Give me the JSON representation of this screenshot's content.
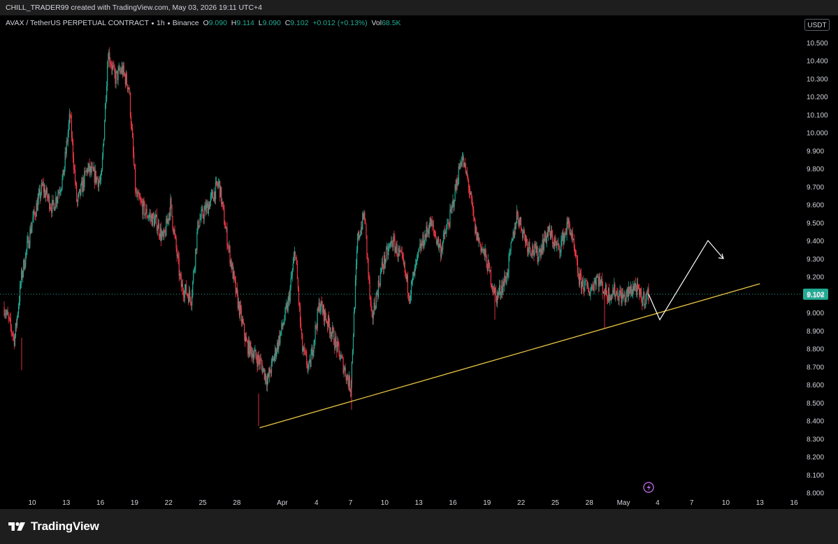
{
  "attribution": "CHILL_TRADER99 created with TradingView.com, May 03, 2026 19:11 UTC+4",
  "header": {
    "symbol": "AVAX / TetherUS PERPETUAL CONTRACT",
    "interval": "1h",
    "exchange": "Binance",
    "open_label": "O",
    "open": "9.090",
    "high_label": "H",
    "high": "9.114",
    "low_label": "L",
    "low": "9.090",
    "close_label": "C",
    "close": "9.102",
    "change": "+0.012 (+0.13%)",
    "vol_label": "Vol",
    "vol": "68.5K"
  },
  "currency_button": "USDT",
  "brand": "TradingView",
  "colors": {
    "up": "#22ab94",
    "down": "#f23645",
    "trendline": "#e8c547",
    "projection": "#ffffff",
    "price_badge": "#22ab94"
  },
  "chart_data": {
    "type": "candlestick",
    "symbol": "AVAX / TetherUS PERPETUAL CONTRACT",
    "timeframe": "1h",
    "y_axis": {
      "range": [
        8.0,
        10.55
      ],
      "ticks": [
        "10.500",
        "10.400",
        "10.300",
        "10.200",
        "10.100",
        "10.000",
        "9.900",
        "9.800",
        "9.700",
        "9.600",
        "9.500",
        "9.400",
        "9.300",
        "9.200",
        "9.100",
        "9.000",
        "8.900",
        "8.800",
        "8.700",
        "8.600",
        "8.500",
        "8.400",
        "8.300",
        "8.200",
        "8.100",
        "8.000"
      ]
    },
    "x_axis": {
      "ticks": [
        "10",
        "13",
        "16",
        "19",
        "22",
        "25",
        "28",
        "Apr",
        "4",
        "7",
        "10",
        "13",
        "16",
        "19",
        "22",
        "25",
        "28",
        "May",
        "4",
        "7",
        "10",
        "13",
        "16"
      ]
    },
    "current_price": {
      "value": 9.102,
      "label": "9.102"
    },
    "price_path": [
      [
        0,
        9.03
      ],
      [
        1.5,
        8.85
      ],
      [
        2.5,
        9.2
      ],
      [
        4,
        9.5
      ],
      [
        5.5,
        9.7
      ],
      [
        7,
        9.58
      ],
      [
        8.5,
        9.75
      ],
      [
        9.5,
        10.1
      ],
      [
        10.5,
        9.6
      ],
      [
        12,
        9.8
      ],
      [
        14,
        9.72
      ],
      [
        15,
        10.45
      ],
      [
        16,
        10.3
      ],
      [
        17,
        10.35
      ],
      [
        18,
        10.25
      ],
      [
        19,
        9.65
      ],
      [
        20.5,
        9.55
      ],
      [
        22,
        9.5
      ],
      [
        23,
        9.4
      ],
      [
        24,
        9.6
      ],
      [
        25.5,
        9.15
      ],
      [
        27,
        9.08
      ],
      [
        28,
        9.5
      ],
      [
        29.5,
        9.6
      ],
      [
        31,
        9.72
      ],
      [
        32,
        9.45
      ],
      [
        33.5,
        9.1
      ],
      [
        35,
        8.82
      ],
      [
        37,
        8.72
      ],
      [
        38,
        8.62
      ],
      [
        40,
        8.9
      ],
      [
        41,
        9.05
      ],
      [
        42,
        9.35
      ],
      [
        43,
        8.8
      ],
      [
        44,
        8.68
      ],
      [
        45.5,
        9.05
      ],
      [
        47,
        8.92
      ],
      [
        49,
        8.7
      ],
      [
        50,
        8.58
      ],
      [
        51,
        9.4
      ],
      [
        52,
        9.55
      ],
      [
        53,
        8.95
      ],
      [
        54.5,
        9.25
      ],
      [
        56,
        9.4
      ],
      [
        57.5,
        9.28
      ],
      [
        58.5,
        9.1
      ],
      [
        60,
        9.35
      ],
      [
        61.5,
        9.5
      ],
      [
        63,
        9.35
      ],
      [
        64.5,
        9.55
      ],
      [
        66,
        9.87
      ],
      [
        67,
        9.72
      ],
      [
        68,
        9.45
      ],
      [
        69.5,
        9.3
      ],
      [
        71,
        9.08
      ],
      [
        72.5,
        9.2
      ],
      [
        74,
        9.55
      ],
      [
        75.5,
        9.38
      ],
      [
        77,
        9.32
      ],
      [
        78.5,
        9.45
      ],
      [
        80,
        9.35
      ],
      [
        81.5,
        9.5
      ],
      [
        83,
        9.18
      ],
      [
        84.5,
        9.12
      ],
      [
        85.5,
        9.2
      ],
      [
        87,
        9.1
      ],
      [
        88,
        9.12
      ],
      [
        89.5,
        9.08
      ],
      [
        91,
        9.15
      ],
      [
        92,
        9.07
      ],
      [
        93,
        9.102
      ]
    ],
    "path_x_days_note_free": true,
    "trendline": {
      "from": [
        "Mar 30",
        8.36
      ],
      "to": [
        "May 13",
        9.16
      ]
    },
    "projection": [
      [
        "May 4",
        9.102
      ],
      [
        "May 5",
        8.96
      ],
      [
        "May 9",
        9.4
      ],
      [
        "May 10",
        9.3
      ]
    ]
  }
}
